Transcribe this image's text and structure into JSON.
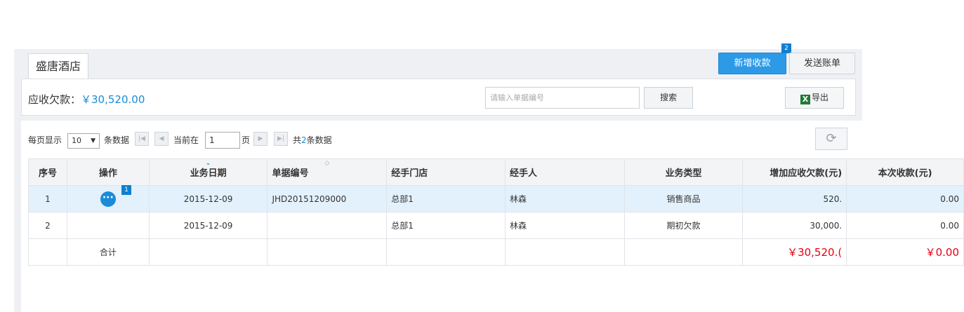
{
  "header": {
    "tab_title": "盛唐酒店",
    "new_payment_label": "新增收款",
    "new_payment_badge": "2",
    "send_bill_label": "发送账单"
  },
  "toolbar": {
    "receivable_label": "应收欠款：",
    "receivable_amount": "￥30,520.00",
    "search_placeholder": "请输入单据编号",
    "search_label": "搜索",
    "export_icon": "excel-icon",
    "export_label": "导出"
  },
  "pager": {
    "per_page_prefix": "每页显示",
    "per_page_value": "10",
    "per_page_suffix": "条数据",
    "current_prefix": "当前在",
    "current_page": "1",
    "page_suffix": "页",
    "total_prefix": "共",
    "total_count": "2",
    "total_suffix": "条数据",
    "refresh_icon": "refresh-icon"
  },
  "table": {
    "columns": [
      "序号",
      "操作",
      "业务日期",
      "单据编号",
      "经手门店",
      "经手人",
      "业务类型",
      "增加应收欠款(元)",
      "本次收款(元)"
    ],
    "rows": [
      {
        "no": "1",
        "date": "2015-12-09",
        "doc_no": "JHD20151209000",
        "store": "总部1",
        "handler": "林森",
        "type": "销售商品",
        "increase": "520.",
        "received": "0.00",
        "op_badge": "1"
      },
      {
        "no": "2",
        "date": "2015-12-09",
        "doc_no": "",
        "store": "总部1",
        "handler": "林森",
        "type": "期初欠款",
        "increase": "30,000.",
        "received": "0.00"
      }
    ],
    "total": {
      "label": "合计",
      "increase": "￥30,520.(",
      "received": "￥0.00"
    }
  },
  "colors": {
    "primary": "#2d9ae8",
    "accent_text": "#1a8bd8",
    "total_red": "#e60012",
    "selected_row": "#e3f1fc"
  }
}
